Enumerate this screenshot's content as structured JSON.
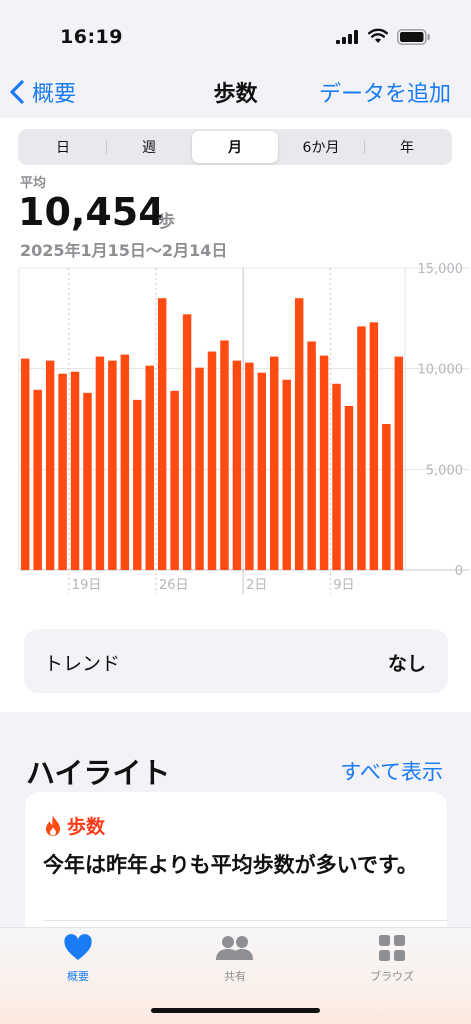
{
  "status": {
    "time": "16:19"
  },
  "nav": {
    "back_label": "概要",
    "title": "歩数",
    "action_label": "データを追加"
  },
  "segments": [
    {
      "label": "日",
      "active": false
    },
    {
      "label": "週",
      "active": false
    },
    {
      "label": "月",
      "active": true
    },
    {
      "label": "6か月",
      "active": false
    },
    {
      "label": "年",
      "active": false
    }
  ],
  "summary": {
    "label": "平均",
    "value": "10,454",
    "unit": "歩",
    "date_range": "2025年1月15日〜2月14日"
  },
  "chart_data": {
    "type": "bar",
    "color": "#ff4a12",
    "ylim": [
      0,
      15000
    ],
    "y_ticks": [
      {
        "value": 0,
        "label": "0"
      },
      {
        "value": 5000,
        "label": "5,000"
      },
      {
        "value": 10000,
        "label": "10,000"
      },
      {
        "value": 15000,
        "label": "15,000"
      }
    ],
    "x_ticks": [
      {
        "index": 4,
        "label": "19日"
      },
      {
        "index": 11,
        "label": "26日"
      },
      {
        "index": 18,
        "label": "2日"
      },
      {
        "index": 25,
        "label": "9日"
      }
    ],
    "categories": [
      "1/15",
      "1/16",
      "1/17",
      "1/18",
      "1/19",
      "1/20",
      "1/21",
      "1/22",
      "1/23",
      "1/24",
      "1/25",
      "1/26",
      "1/27",
      "1/28",
      "1/29",
      "1/30",
      "1/31",
      "2/1",
      "2/2",
      "2/3",
      "2/4",
      "2/5",
      "2/6",
      "2/7",
      "2/8",
      "2/9",
      "2/10",
      "2/11",
      "2/12",
      "2/13",
      "2/14"
    ],
    "values": [
      10500,
      8950,
      10400,
      9750,
      9850,
      8800,
      10600,
      10400,
      10700,
      8450,
      10150,
      13500,
      8900,
      12700,
      10050,
      10850,
      11400,
      10400,
      10300,
      9800,
      10600,
      9450,
      13500,
      11350,
      10650,
      9250,
      8150,
      12100,
      12300,
      7250,
      10600
    ]
  },
  "trend": {
    "label": "トレンド",
    "value": "なし"
  },
  "highlights": {
    "title": "ハイライト",
    "show_all": "すべて表示",
    "card": {
      "category": "歩数",
      "text": "今年は昨年よりも平均歩数が多いです。"
    }
  },
  "tabbar": [
    {
      "label": "概要",
      "icon": "heart-icon",
      "active": true
    },
    {
      "label": "共有",
      "icon": "people-icon",
      "active": false
    },
    {
      "label": "ブラウズ",
      "icon": "grid-icon",
      "active": false
    }
  ]
}
